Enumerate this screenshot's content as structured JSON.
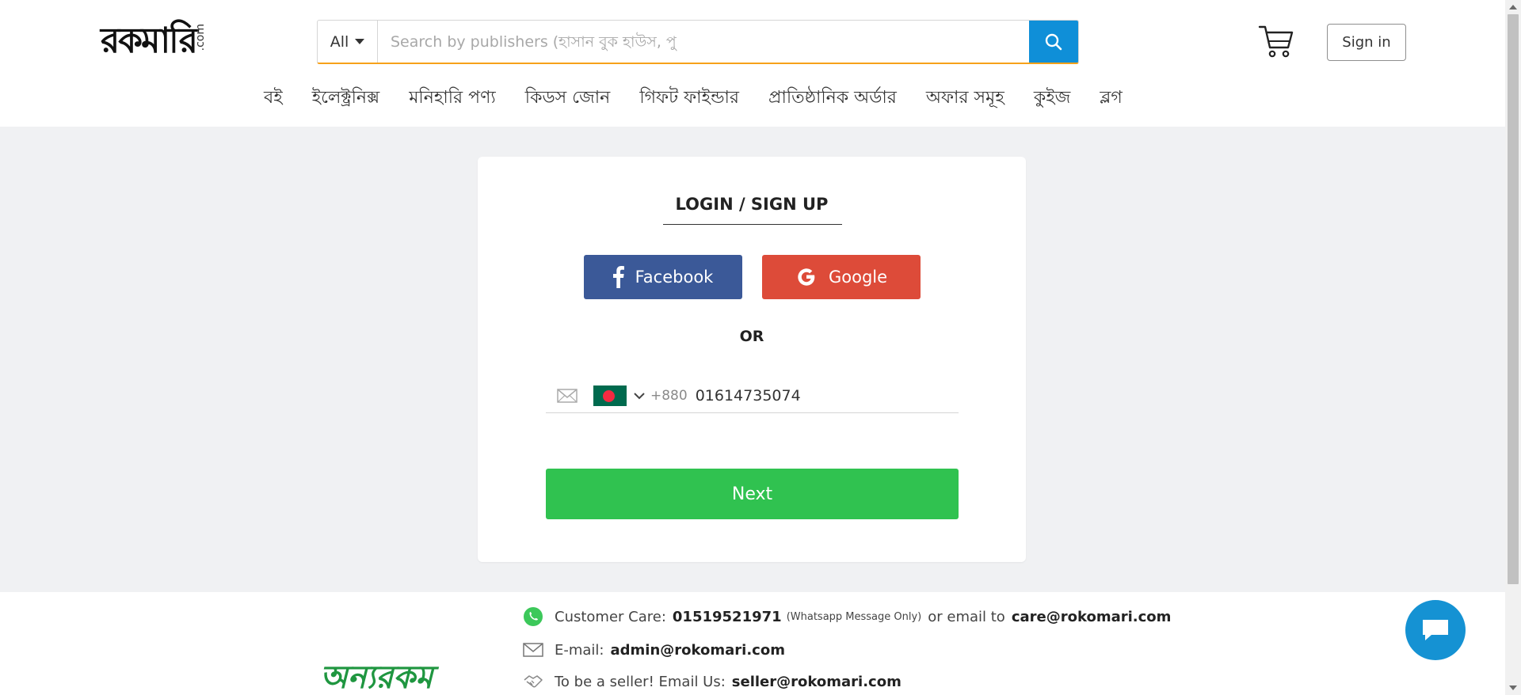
{
  "header": {
    "logo": {
      "text": "রকমারি",
      "suffix": ".com"
    },
    "search": {
      "category": "All",
      "placeholder": "Search by publishers (হাসান বুক হাউস, পু"
    },
    "signin_label": "Sign in"
  },
  "nav": {
    "items": [
      {
        "label": "বই"
      },
      {
        "label": "ইলেক্ট্রনিক্স"
      },
      {
        "label": "মনিহারি পণ্য"
      },
      {
        "label": "কিডস জোন"
      },
      {
        "label": "গিফট ফাইন্ডার"
      },
      {
        "label": "প্রাতিষ্ঠানিক অর্ডার"
      },
      {
        "label": "অফার সমূহ"
      },
      {
        "label": "কুইজ"
      },
      {
        "label": "ব্লগ"
      }
    ]
  },
  "login": {
    "title": "LOGIN / SIGN UP",
    "facebook_label": "Facebook",
    "google_label": "Google",
    "or_label": "OR",
    "country_code": "+880",
    "phone_value": "01614735074",
    "next_label": "Next"
  },
  "footer": {
    "logo_text": "অন্যরকম",
    "care_label": "Customer Care:",
    "care_number": "01519521971",
    "care_note": "(Whatsapp Message Only)",
    "or_email_label": "or email to",
    "care_email": "care@rokomari.com",
    "email_label": "E-mail:",
    "admin_email": "admin@rokomari.com",
    "seller_label": "To be a seller! Email Us:",
    "seller_email": "seller@rokomari.com"
  },
  "colors": {
    "search_button": "#0f8fd8",
    "search_underline": "#f7a11a",
    "facebook": "#3b5998",
    "google": "#dd4b39",
    "next": "#30c250",
    "chat": "#1592d3",
    "page_bg": "#f0f1f3"
  },
  "icons": [
    "search-icon",
    "cart-icon",
    "facebook-icon",
    "google-icon",
    "mail-icon",
    "chevron-down-icon",
    "whatsapp-icon",
    "handshake-icon",
    "chat-icon"
  ]
}
